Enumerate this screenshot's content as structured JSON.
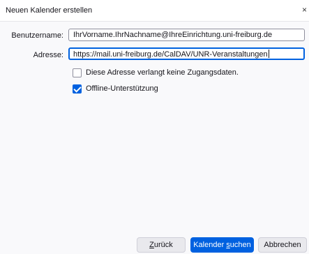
{
  "window": {
    "title": "Neuen Kalender erstellen",
    "close_glyph": "×"
  },
  "form": {
    "username_label": "Benutzername:",
    "username_value": "IhrVorname.IhrNachname@IhreEinrichtung.uni-freiburg.de",
    "address_label": "Adresse:",
    "address_value": "https://mail.uni-freiburg.de/CalDAV/UNR-Veranstaltungen",
    "no_credentials_label": "Diese Adresse verlangt keine Zugangsdaten.",
    "no_credentials_checked": false,
    "offline_label": "Offline-Unterstützung",
    "offline_checked": true
  },
  "buttons": {
    "back_prefix": "",
    "back_accel": "Z",
    "back_rest": "urück",
    "find_prefix": "Kalender ",
    "find_accel": "s",
    "find_rest": "uchen",
    "cancel_label": "Abbrechen"
  },
  "colors": {
    "accent": "#0061e0",
    "background": "#f9f9fb"
  }
}
